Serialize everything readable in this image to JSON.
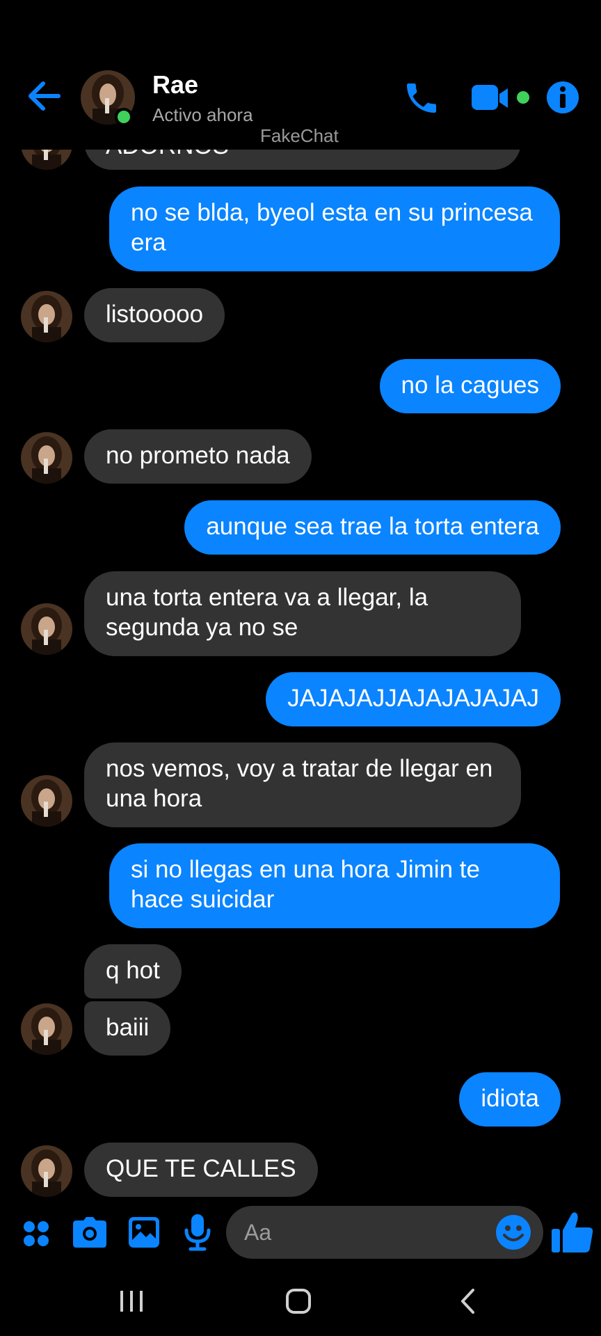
{
  "header": {
    "contact_name": "Rae",
    "status": "Activo ahora",
    "watermark": "FakeChat",
    "icons": {
      "back": "back-arrow-icon",
      "call": "phone-icon",
      "video": "video-camera-icon",
      "info": "info-icon"
    }
  },
  "colors": {
    "accent": "#0a84ff",
    "incoming_bubble": "#333333",
    "online": "#3fd15a",
    "background": "#000000"
  },
  "messages": [
    {
      "side": "in",
      "text": "ADORNOS"
    },
    {
      "side": "out",
      "text": "no se blda, byeol esta en su princesa era"
    },
    {
      "side": "in",
      "text": "listooooo"
    },
    {
      "side": "out",
      "text": "no la cagues"
    },
    {
      "side": "in",
      "text": "no prometo nada"
    },
    {
      "side": "out",
      "text": "aunque sea trae la torta entera"
    },
    {
      "side": "in",
      "text": "una torta entera va a llegar, la segunda ya no se"
    },
    {
      "side": "out",
      "text": "JAJAJAJJAJAJAJAJAJ"
    },
    {
      "side": "in",
      "text": "nos vemos, voy a tratar de llegar en una hora"
    },
    {
      "side": "out",
      "text": "si no llegas en una hora Jimin te hace suicidar"
    },
    {
      "side": "in",
      "text": "q hot"
    },
    {
      "side": "in",
      "text": "baiii"
    },
    {
      "side": "out",
      "text": "idiota"
    },
    {
      "side": "in",
      "text": "QUE TE CALLES"
    }
  ],
  "composer": {
    "placeholder": "Aa",
    "icons": [
      "apps-grid-icon",
      "camera-icon",
      "gallery-image-icon",
      "microphone-icon",
      "emoji-icon",
      "thumbs-up-icon"
    ]
  },
  "system_nav": {
    "icons": [
      "recent-apps-icon",
      "home-icon",
      "back-icon"
    ]
  }
}
